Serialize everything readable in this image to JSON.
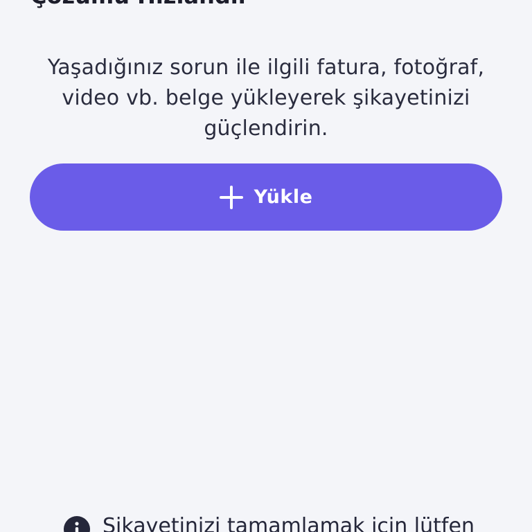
{
  "header": {
    "title": "Çözümü Hızlandır"
  },
  "upload_section": {
    "description": "Yaşadığınız sorun ile ilgili fatura, fotoğraf, video vb. belge yükleyerek şikayetinizi güçlendirin.",
    "button_label": "Yükle",
    "button_icon": "plus-icon",
    "button_color": "#6a5ce8"
  },
  "notice": {
    "icon": "info-icon",
    "text": "Şikayetinizi tamamlamak için lütfen"
  }
}
